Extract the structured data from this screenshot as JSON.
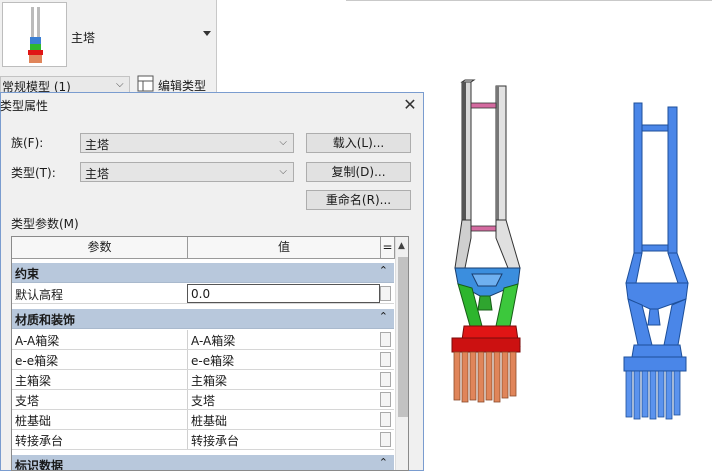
{
  "palette": {
    "family_name": "主塔",
    "instance_type": "常规模型 (1)",
    "edit_type_label": "编辑类型"
  },
  "dialog": {
    "title": "类型属性",
    "family_label": "族(F):",
    "family_value": "主塔",
    "type_label": "类型(T):",
    "type_value": "主塔",
    "load_button": "载入(L)...",
    "duplicate_button": "复制(D)...",
    "rename_button": "重命名(R)...",
    "type_params_label": "类型参数(M)",
    "col_param": "参数",
    "col_value": "值",
    "col_eq": "="
  },
  "groups": [
    {
      "title": "约束",
      "icon": "collapse-icon",
      "rows": [
        {
          "name": "默认高程",
          "value": "0.0"
        }
      ]
    },
    {
      "title": "材质和装饰",
      "icon": "collapse-icon",
      "rows": [
        {
          "name": "A-A箱梁",
          "value": "A-A箱梁"
        },
        {
          "name": "e-e箱梁",
          "value": "e-e箱梁"
        },
        {
          "name": "主箱梁",
          "value": "主箱梁"
        },
        {
          "name": "支塔",
          "value": "支塔"
        },
        {
          "name": "桩基础",
          "value": "桩基础"
        },
        {
          "name": "转接承台",
          "value": "转接承台"
        }
      ]
    },
    {
      "title": "标识数据",
      "icon": "collapse-icon",
      "rows": []
    }
  ],
  "icons": {
    "collapse": "⌃"
  },
  "colors": {
    "tower_gray": "#dcdcdc",
    "tower_blue": "#3b7fd4",
    "tower_green": "#2fb82f",
    "cap_red": "#e01515",
    "pile_orange": "#e0855a",
    "mono_blue": "#4a86e8",
    "group_header": "#b8c8dc"
  }
}
